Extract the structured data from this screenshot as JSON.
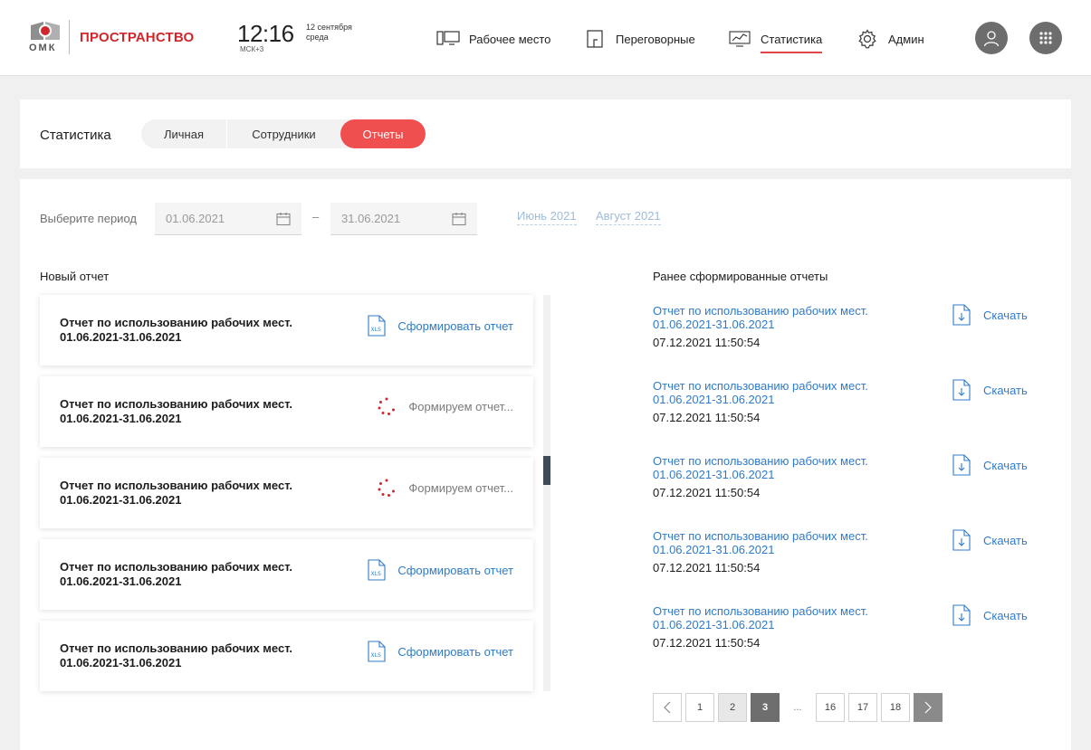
{
  "header": {
    "logo_text": "ОМК",
    "brand": "ПРОСТРАНСТВО",
    "time": "12:16",
    "timezone": "МСК+3",
    "date_line1": "12 сентября",
    "date_line2": "среда",
    "nav": [
      {
        "label": "Рабочее место",
        "icon": "workspace-icon"
      },
      {
        "label": "Переговорные",
        "icon": "meeting-room-icon"
      },
      {
        "label": "Статистика",
        "icon": "statistics-icon",
        "active": true
      },
      {
        "label": "Админ",
        "icon": "gear-icon"
      }
    ]
  },
  "stats": {
    "title": "Статистика",
    "tabs": [
      "Личная",
      "Сотрудники",
      "Отчеты"
    ],
    "active_tab": "Отчеты"
  },
  "period": {
    "label": "Выберите период",
    "from": "01.06.2021",
    "to": "31.06.2021",
    "separator": "–",
    "quick": [
      "Июнь 2021",
      "Август 2021"
    ]
  },
  "new_reports": {
    "title": "Новый отчет",
    "items": [
      {
        "name_line1": "Отчет по использованию рабочих мест.",
        "name_line2": "01.06.2021-31.06.2021",
        "action": "Сформировать отчет",
        "state": "ready"
      },
      {
        "name_line1": "Отчет по использованию рабочих мест.",
        "name_line2": "01.06.2021-31.06.2021",
        "action": "Формируем отчет...",
        "state": "busy"
      },
      {
        "name_line1": "Отчет по использованию рабочих мест.",
        "name_line2": "01.06.2021-31.06.2021",
        "action": "Формируем отчет...",
        "state": "busy"
      },
      {
        "name_line1": "Отчет по использованию рабочих мест.",
        "name_line2": "01.06.2021-31.06.2021",
        "action": "Сформировать отчет",
        "state": "ready"
      },
      {
        "name_line1": "Отчет по использованию рабочих мест.",
        "name_line2": "01.06.2021-31.06.2021",
        "action": "Сформировать отчет",
        "state": "ready"
      }
    ],
    "file_badge": "XLS"
  },
  "previous_reports": {
    "title": "Ранее сформированные отчеты",
    "download_label": "Скачать",
    "items": [
      {
        "name_line1": "Отчет по использованию рабочих мест.",
        "name_line2": "01.06.2021-31.06.2021",
        "created": "07.12.2021 11:50:54"
      },
      {
        "name_line1": "Отчет по использованию рабочих мест.",
        "name_line2": "01.06.2021-31.06.2021",
        "created": "07.12.2021 11:50:54"
      },
      {
        "name_line1": "Отчет по использованию рабочих мест.",
        "name_line2": "01.06.2021-31.06.2021",
        "created": "07.12.2021 11:50:54"
      },
      {
        "name_line1": "Отчет по использованию рабочих мест.",
        "name_line2": "01.06.2021-31.06.2021",
        "created": "07.12.2021 11:50:54"
      },
      {
        "name_line1": "Отчет по использованию рабочих мест.",
        "name_line2": "01.06.2021-31.06.2021",
        "created": "07.12.2021 11:50:54"
      }
    ]
  },
  "pagination": {
    "pages": [
      "1",
      "2",
      "3",
      "...",
      "16",
      "17",
      "18"
    ],
    "current": "3",
    "visited": "2"
  },
  "colors": {
    "accent_red": "#ef4f4f",
    "brand_red": "#d0272d",
    "link_blue": "#2f7bc9"
  }
}
